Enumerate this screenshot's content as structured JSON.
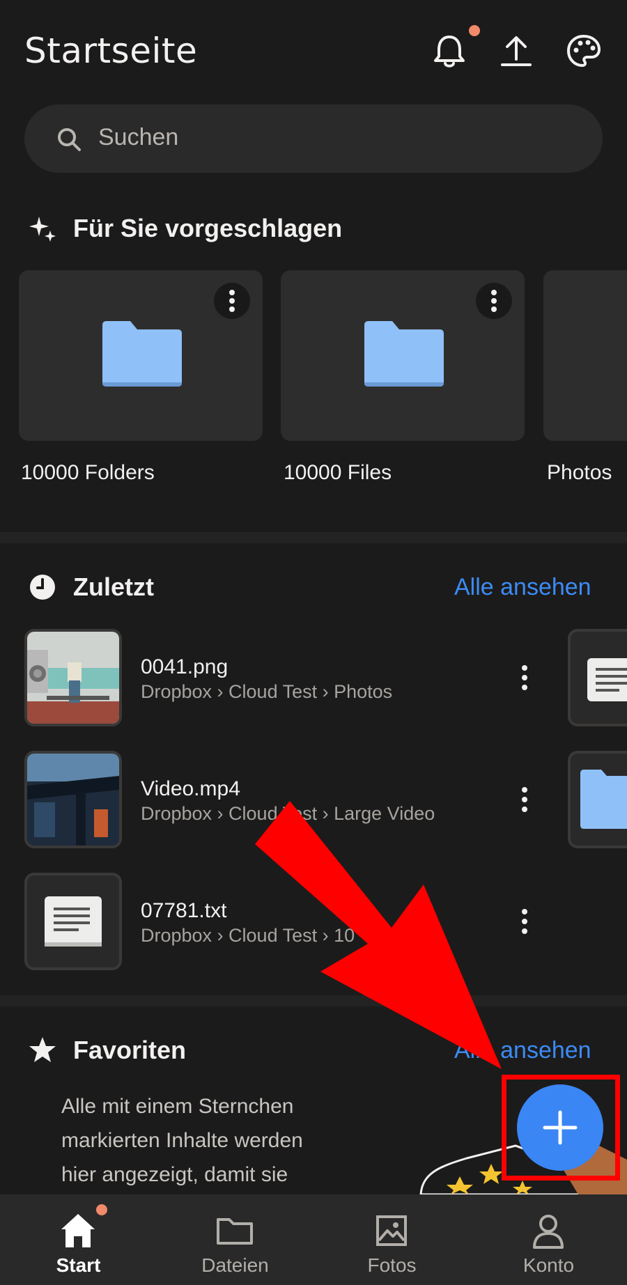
{
  "header": {
    "title": "Startseite",
    "icons": [
      "bell-icon",
      "upload-icon",
      "palette-icon"
    ]
  },
  "search": {
    "placeholder": "Suchen"
  },
  "suggested": {
    "title": "Für Sie vorgeschlagen",
    "items": [
      {
        "label": "10000 Folders",
        "icon": "folder-icon"
      },
      {
        "label": "10000 Files",
        "icon": "folder-icon"
      },
      {
        "label": "Photos",
        "icon": "folder-icon"
      }
    ]
  },
  "recent": {
    "title": "Zuletzt",
    "see_all": "Alle ansehen",
    "items": [
      {
        "name": "0041.png",
        "path": "Dropbox › Cloud Test › Photos"
      },
      {
        "name": "Video.mp4",
        "path": "Dropbox › Cloud Test › Large Video"
      },
      {
        "name": "07781.txt",
        "path": "Dropbox › Cloud Test › 10"
      }
    ]
  },
  "favorites": {
    "title": "Favoriten",
    "see_all": "Alle ansehen",
    "lines": [
      "Alle mit einem Sternchen",
      "markierten Inhalte werden",
      "hier angezeigt, damit sie"
    ]
  },
  "nav": {
    "items": [
      {
        "label": "Start",
        "active": true
      },
      {
        "label": "Dateien",
        "active": false
      },
      {
        "label": "Fotos",
        "active": false
      },
      {
        "label": "Konto",
        "active": false
      }
    ]
  },
  "colors": {
    "background": "#1c1b1b",
    "accent": "#3a86f4",
    "link": "#3c8cf5",
    "notification": "#f08a6a",
    "folder": "#90c0f8",
    "annotation": "#ff0000"
  }
}
